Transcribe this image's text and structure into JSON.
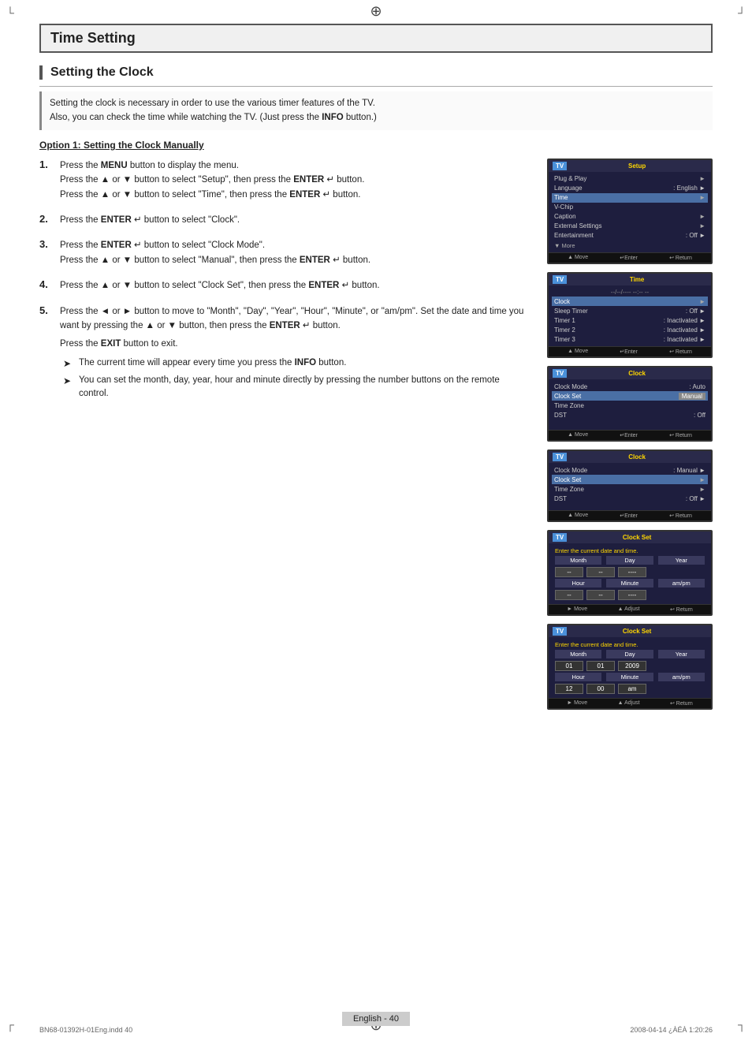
{
  "page": {
    "title": "Time Setting",
    "section_title": "Setting the Clock",
    "description_line1": "Setting the clock is necessary in order to use the various timer features of the TV.",
    "description_line2": "Also, you can check the time while watching the TV. (Just press the ",
    "description_line2_bold": "INFO",
    "description_line2_end": " button.)",
    "option_heading": "Option 1: Setting the Clock Manually",
    "footer_text": "English - 40",
    "bottom_left": "BN68-01392H-01Eng.indd   40",
    "bottom_right": "2008-04-14   ¿ÀÉÀ 1:20:26"
  },
  "steps": [
    {
      "number": "1.",
      "lines": [
        {
          "text": "Press the ",
          "bold_word": "MENU",
          "rest": " button to display the menu."
        },
        {
          "text": "Press the ▲ or ▼ button to select \"Setup\", then press the ",
          "bold_word": "ENTER",
          "rest": " ↵ button."
        },
        {
          "text": "Press the ▲ or ▼ button to select \"Time\", then press the ",
          "bold_word": "ENTER",
          "rest": " ↵ button."
        }
      ]
    },
    {
      "number": "2.",
      "lines": [
        {
          "text": "Press the ",
          "bold_word": "ENTER",
          "rest": " ↵ button to select \"Clock\"."
        }
      ]
    },
    {
      "number": "3.",
      "lines": [
        {
          "text": "Press the ",
          "bold_word": "ENTER",
          "rest": " ↵ button to select \"Clock Mode\"."
        },
        {
          "text": "Press the ▲ or ▼ button to select \"Manual\", then press the ",
          "bold_word": "ENTER",
          "rest": " ↵ button."
        }
      ]
    },
    {
      "number": "4.",
      "lines": [
        {
          "text": "Press the ▲ or ▼ button to select \"Clock Set\", then press the ",
          "bold_word": "ENTER",
          "rest": " ↵ button."
        }
      ]
    },
    {
      "number": "5.",
      "lines": [
        {
          "text": "Press the ◄ or ► button to move to \"Month\", \"Day\", \"Year\", \"Hour\", \"Minute\", or \"am/pm\". Set the date and time you want by pressing the ▲ or ▼ button, then press the ",
          "bold_word": "ENTER",
          "rest": " ↵ button."
        },
        {
          "text": "Press the ",
          "bold_word": "EXIT",
          "rest": " button to exit."
        }
      ],
      "bullets": [
        "The current time will appear every time you press the INFO button.",
        "You can set the month, day, year, hour and minute directly by pressing the number buttons on the remote control."
      ]
    }
  ],
  "screens": [
    {
      "id": "screen1",
      "tv_label": "TV",
      "screen_title": "Setup",
      "items": [
        {
          "label": "Plug & Play",
          "value": "",
          "arrow": "►",
          "highlighted": false
        },
        {
          "label": "Language",
          "value": ": English",
          "arrow": "►",
          "highlighted": false
        },
        {
          "label": "Time",
          "value": "",
          "arrow": "►",
          "highlighted": true
        },
        {
          "label": "V-Chip",
          "value": "",
          "arrow": "",
          "highlighted": false
        },
        {
          "label": "Caption",
          "value": "",
          "arrow": "►",
          "highlighted": false
        },
        {
          "label": "External Settings",
          "value": "",
          "arrow": "►",
          "highlighted": false
        },
        {
          "label": "Entertainment",
          "value": ": Off",
          "arrow": "►",
          "highlighted": false
        },
        {
          "label": "▼ More",
          "value": "",
          "arrow": "",
          "highlighted": false
        }
      ],
      "footer": [
        "▲ Move",
        "↵Enter",
        "↩ Return"
      ]
    },
    {
      "id": "screen2",
      "tv_label": "TV",
      "screen_title": "Time",
      "top_text": "--/--/----  --:-- --",
      "items": [
        {
          "label": "Clock",
          "value": "",
          "arrow": "►",
          "highlighted": true
        },
        {
          "label": "Sleep Timer",
          "value": ": Off",
          "arrow": "►",
          "highlighted": false
        },
        {
          "label": "Timer 1",
          "value": ": Inactivated",
          "arrow": "►",
          "highlighted": false
        },
        {
          "label": "Timer 2",
          "value": ": Inactivated",
          "arrow": "►",
          "highlighted": false
        },
        {
          "label": "Timer 3",
          "value": ": Inactivated",
          "arrow": "►",
          "highlighted": false
        }
      ],
      "footer": [
        "▲ Move",
        "↵Enter",
        "↩ Return"
      ]
    },
    {
      "id": "screen3",
      "tv_label": "TV",
      "screen_title": "Clock",
      "items": [
        {
          "label": "Clock Mode",
          "value": ": Auto",
          "arrow": "",
          "highlighted": false
        },
        {
          "label": "Clock Set",
          "value": "Manual",
          "arrow": "",
          "highlighted": true,
          "box": true
        },
        {
          "label": "Time Zone",
          "value": "",
          "arrow": "",
          "highlighted": false
        },
        {
          "label": "DST",
          "value": ": Off",
          "arrow": "",
          "highlighted": false
        }
      ],
      "footer": [
        "▲ Move",
        "↵Enter",
        "↩ Return"
      ]
    },
    {
      "id": "screen4",
      "tv_label": "TV",
      "screen_title": "Clock",
      "items": [
        {
          "label": "Clock Mode",
          "value": ": Manual",
          "arrow": "►",
          "highlighted": false
        },
        {
          "label": "Clock Set",
          "value": "",
          "arrow": "►",
          "highlighted": true
        },
        {
          "label": "Time Zone",
          "value": "",
          "arrow": "►",
          "highlighted": false
        },
        {
          "label": "DST",
          "value": ": Off",
          "arrow": "►",
          "highlighted": false
        }
      ],
      "footer": [
        "▲ Move",
        "↵Enter",
        "↩ Return"
      ]
    },
    {
      "id": "screen5",
      "tv_label": "TV",
      "screen_title": "Clock Set",
      "date_info": "Enter the current date and time.",
      "col_headers": [
        "Month",
        "Day",
        "Year"
      ],
      "date_values": [
        "--",
        "--",
        "----"
      ],
      "time_headers": [
        "Hour",
        "Minute",
        "am/pm"
      ],
      "time_values": [
        "--",
        "--",
        "----"
      ],
      "footer": [
        "► Move",
        "▲ Adjust",
        "↩ Return"
      ]
    },
    {
      "id": "screen6",
      "tv_label": "TV",
      "screen_title": "Clock Set",
      "date_info": "Enter the current date and time.",
      "col_headers": [
        "Month",
        "Day",
        "Year"
      ],
      "date_values": [
        "01",
        "01",
        "2009"
      ],
      "time_headers": [
        "Hour",
        "Minute",
        "am/pm"
      ],
      "time_values": [
        "12",
        "00",
        "am"
      ],
      "footer": [
        "► Move",
        "▲ Adjust",
        "↩ Return"
      ]
    }
  ]
}
